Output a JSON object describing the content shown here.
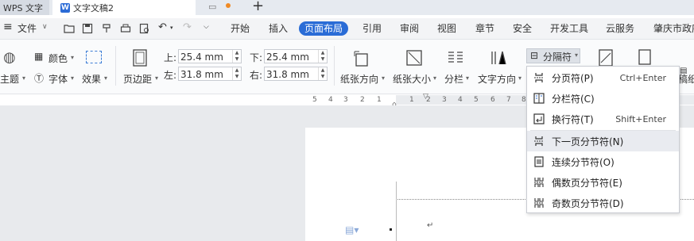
{
  "titlebar": {
    "app_tab": "WPS 文字",
    "doc_tab": "文字文稿2",
    "new_tab": "+"
  },
  "menu": {
    "file": "文件",
    "items": [
      "开始",
      "插入",
      "页面布局",
      "引用",
      "审阅",
      "视图",
      "章节",
      "安全",
      "开发工具",
      "云服务",
      "肇庆市政府"
    ],
    "active": "页面布局"
  },
  "ribbon": {
    "theme": "主题",
    "color": "颜色",
    "font": "字体",
    "effect": "效果",
    "margins": "页边距",
    "top_label": "上:",
    "top_value": "25.4 mm",
    "bottom_label": "下:",
    "bottom_value": "25.4 mm",
    "left_label": "左:",
    "left_value": "31.8 mm",
    "right_label": "右:",
    "right_value": "31.8 mm",
    "orientation": "纸张方向",
    "size": "纸张大小",
    "columns": "分栏",
    "text_direction": "文字方向",
    "separator": "分隔符",
    "manuscript": "稿纸"
  },
  "ruler": {
    "numbers": [
      "5",
      "4",
      "3",
      "2",
      "1",
      "",
      "1",
      "2",
      "3",
      "4",
      "5",
      "6",
      "7",
      "8"
    ]
  },
  "dropdown": {
    "items": [
      {
        "label": "分页符(P)",
        "shortcut": "Ctrl+Enter",
        "icon": "page-break-icon"
      },
      {
        "label": "分栏符(C)",
        "shortcut": "",
        "icon": "column-break-icon"
      },
      {
        "label": "换行符(T)",
        "shortcut": "Shift+Enter",
        "icon": "line-break-icon"
      },
      {
        "label": "下一页分节符(N)",
        "shortcut": "",
        "icon": "next-page-section-icon"
      },
      {
        "label": "连续分节符(O)",
        "shortcut": "",
        "icon": "continuous-section-icon"
      },
      {
        "label": "偶数页分节符(E)",
        "shortcut": "",
        "icon": "even-page-section-icon"
      },
      {
        "label": "奇数页分节符(D)",
        "shortcut": "",
        "icon": "odd-page-section-icon"
      }
    ],
    "hovered_index": 3
  },
  "colors": {
    "accent": "#2a6cd6",
    "titlebar": "#e6eaf0",
    "doc_bg": "#e8eaed"
  }
}
